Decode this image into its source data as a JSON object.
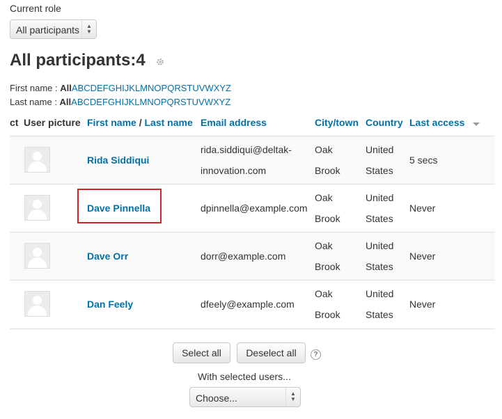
{
  "role_filter": {
    "label": "Current role",
    "selected": "All participants"
  },
  "title": "All participants:4",
  "first_name_filter": {
    "label": "First name : ",
    "all": "All",
    "letters": [
      "A",
      "B",
      "C",
      "D",
      "E",
      "F",
      "G",
      "H",
      "I",
      "J",
      "K",
      "L",
      "M",
      "N",
      "O",
      "P",
      "Q",
      "R",
      "S",
      "T",
      "U",
      "V",
      "W",
      "X",
      "Y",
      "Z"
    ]
  },
  "last_name_filter": {
    "label": "Last name : ",
    "all": "All",
    "letters": [
      "A",
      "B",
      "C",
      "D",
      "E",
      "F",
      "G",
      "H",
      "I",
      "J",
      "K",
      "L",
      "M",
      "N",
      "O",
      "P",
      "Q",
      "R",
      "S",
      "T",
      "U",
      "V",
      "W",
      "X",
      "Y",
      "Z"
    ]
  },
  "columns": {
    "select": "ct",
    "user_picture": "User picture",
    "first_name": "First name",
    "slash": " / ",
    "last_name": "Last name",
    "email": "Email address",
    "city": "City/town",
    "country": "Country",
    "last_access": "Last access"
  },
  "rows": [
    {
      "name": "Rida Siddiqui",
      "email_line1": "rida.siddiqui@deltak-",
      "email_line2": "innovation.com",
      "city_line1": "Oak",
      "city_line2": "Brook",
      "country_line1": "United",
      "country_line2": "States",
      "last_access": "5 secs"
    },
    {
      "name": "Dave Pinnella",
      "email_line1": "dpinnella@example.com",
      "email_line2": "",
      "city_line1": "Oak",
      "city_line2": "Brook",
      "country_line1": "United",
      "country_line2": "States",
      "last_access": "Never"
    },
    {
      "name": "Dave Orr",
      "email_line1": "dorr@example.com",
      "email_line2": "",
      "city_line1": "Oak",
      "city_line2": "Brook",
      "country_line1": "United",
      "country_line2": "States",
      "last_access": "Never"
    },
    {
      "name": "Dan Feely",
      "email_line1": "dfeely@example.com",
      "email_line2": "",
      "city_line1": "Oak",
      "city_line2": "Brook",
      "country_line1": "United",
      "country_line2": "States",
      "last_access": "Never"
    }
  ],
  "actions": {
    "select_all": "Select all",
    "deselect_all": "Deselect all",
    "help": "?"
  },
  "bulk": {
    "label": "With selected users...",
    "choose": "Choose..."
  },
  "colors": {
    "link": "#0070a8",
    "highlight": "#d2232a"
  }
}
